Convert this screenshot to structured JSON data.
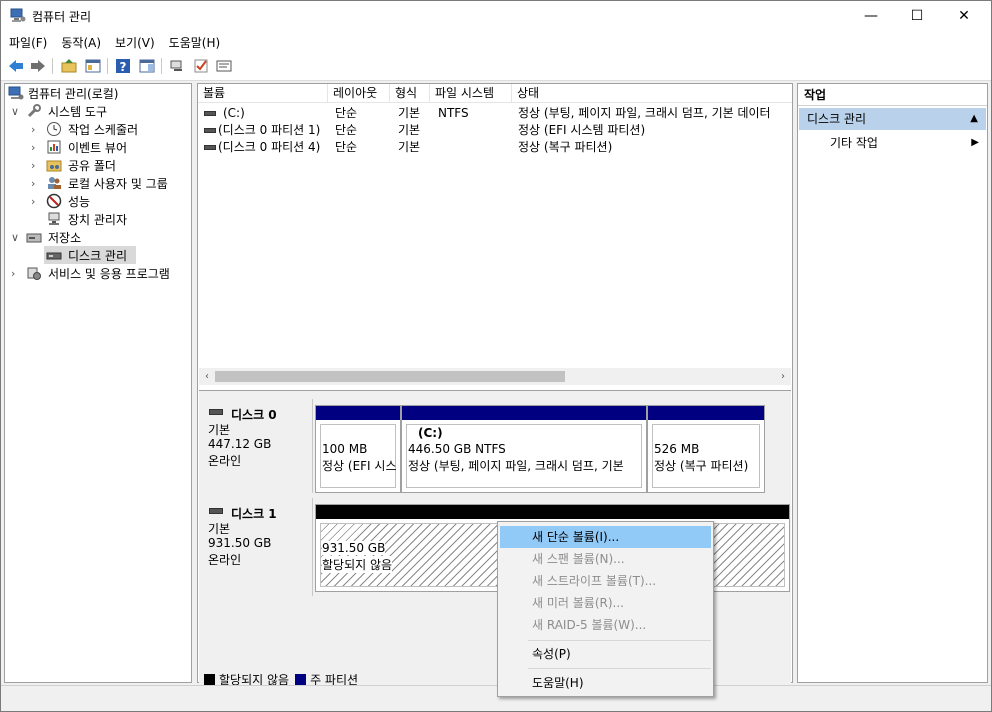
{
  "window": {
    "title": "컴퓨터 관리",
    "controls": {
      "minimize": "—",
      "maximize": "☐",
      "close": "✕"
    }
  },
  "menu": [
    "파일(F)",
    "동작(A)",
    "보기(V)",
    "도움말(H)"
  ],
  "toolbar_icons": [
    "back-icon",
    "forward-icon",
    "up-folder-icon",
    "show-hide-tree-icon",
    "help-icon",
    "show-action-pane-icon",
    "connect-icon",
    "check-icon",
    "properties-icon"
  ],
  "tree": {
    "root": "컴퓨터 관리(로컬)",
    "system_tools": "시스템 도구",
    "task_scheduler": "작업 스케줄러",
    "event_viewer": "이벤트 뷰어",
    "shared_folders": "공유 폴더",
    "local_users": "로컬 사용자 및 그룹",
    "performance": "성능",
    "device_manager": "장치 관리자",
    "storage": "저장소",
    "disk_management": "디스크 관리",
    "services": "서비스 및 응용 프로그램"
  },
  "volume_list": {
    "columns": [
      "볼륨",
      "레이아웃",
      "형식",
      "파일 시스템",
      "상태"
    ],
    "rows": [
      {
        "volume": "(C:)",
        "layout": "단순",
        "type": "기본",
        "fs": "NTFS",
        "status": "정상 (부팅, 페이지 파일, 크래시 덤프, 기본 데이터"
      },
      {
        "volume": "(디스크 0 파티션 1)",
        "layout": "단순",
        "type": "기본",
        "fs": "",
        "status": "정상 (EFI 시스템 파티션)"
      },
      {
        "volume": "(디스크 0 파티션 4)",
        "layout": "단순",
        "type": "기본",
        "fs": "",
        "status": "정상 (복구 파티션)"
      }
    ],
    "scroll_left": "‹",
    "scroll_right": "›"
  },
  "disks": [
    {
      "name": "디스크 0",
      "type": "기본",
      "size": "447.12 GB",
      "state": "온라인",
      "partitions": [
        {
          "label": "",
          "size": "100 MB",
          "status": "정상 (EFI 시스"
        },
        {
          "label": "(C:)",
          "size": "446.50 GB NTFS",
          "status": "정상 (부팅, 페이지 파일, 크래시 덤프, 기본"
        },
        {
          "label": "",
          "size": "526 MB",
          "status": "정상 (복구 파티션)"
        }
      ]
    },
    {
      "name": "디스크 1",
      "type": "기본",
      "size": "931.50 GB",
      "state": "온라인",
      "partitions": [
        {
          "label": "",
          "size": "931.50 GB",
          "status": "할당되지 않음"
        }
      ]
    }
  ],
  "legend": {
    "unallocated": "할당되지 않음",
    "primary": "주 파티션",
    "unallocated_color": "#000000",
    "primary_color": "#000080"
  },
  "actions": {
    "title": "작업",
    "section": "디스크 관리",
    "section_arrow": "▲",
    "more": "기타 작업",
    "more_arrow": "▶"
  },
  "context_menu": {
    "items": [
      {
        "label": "새 단순 볼륨(I)...",
        "enabled": true,
        "highlighted": true
      },
      {
        "label": "새 스팬 볼륨(N)...",
        "enabled": false
      },
      {
        "label": "새 스트라이프 볼륨(T)...",
        "enabled": false
      },
      {
        "label": "새 미러 볼륨(R)...",
        "enabled": false
      },
      {
        "label": "새 RAID-5 볼륨(W)...",
        "enabled": false
      },
      {
        "label": "속성(P)",
        "enabled": true
      },
      {
        "label": "도움말(H)",
        "enabled": true
      }
    ]
  }
}
